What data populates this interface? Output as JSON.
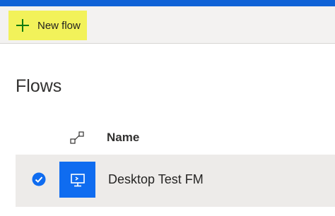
{
  "toolbar": {
    "new_flow_label": "New flow",
    "new_flow_icon": "plus-icon",
    "highlight_color": "#f2f25a",
    "plus_color": "#107c10"
  },
  "page": {
    "title": "Flows"
  },
  "table": {
    "columns": {
      "type_icon": "flow-type-icon",
      "name": "Name"
    },
    "rows": [
      {
        "selected": true,
        "icon": "desktop-flow-icon",
        "name": "Desktop Test FM"
      }
    ]
  },
  "colors": {
    "accent": "#0f62d6",
    "tile": "#0f6cf0",
    "selected_row": "#edebe9",
    "toolbar_bg": "#f3f2f1"
  }
}
